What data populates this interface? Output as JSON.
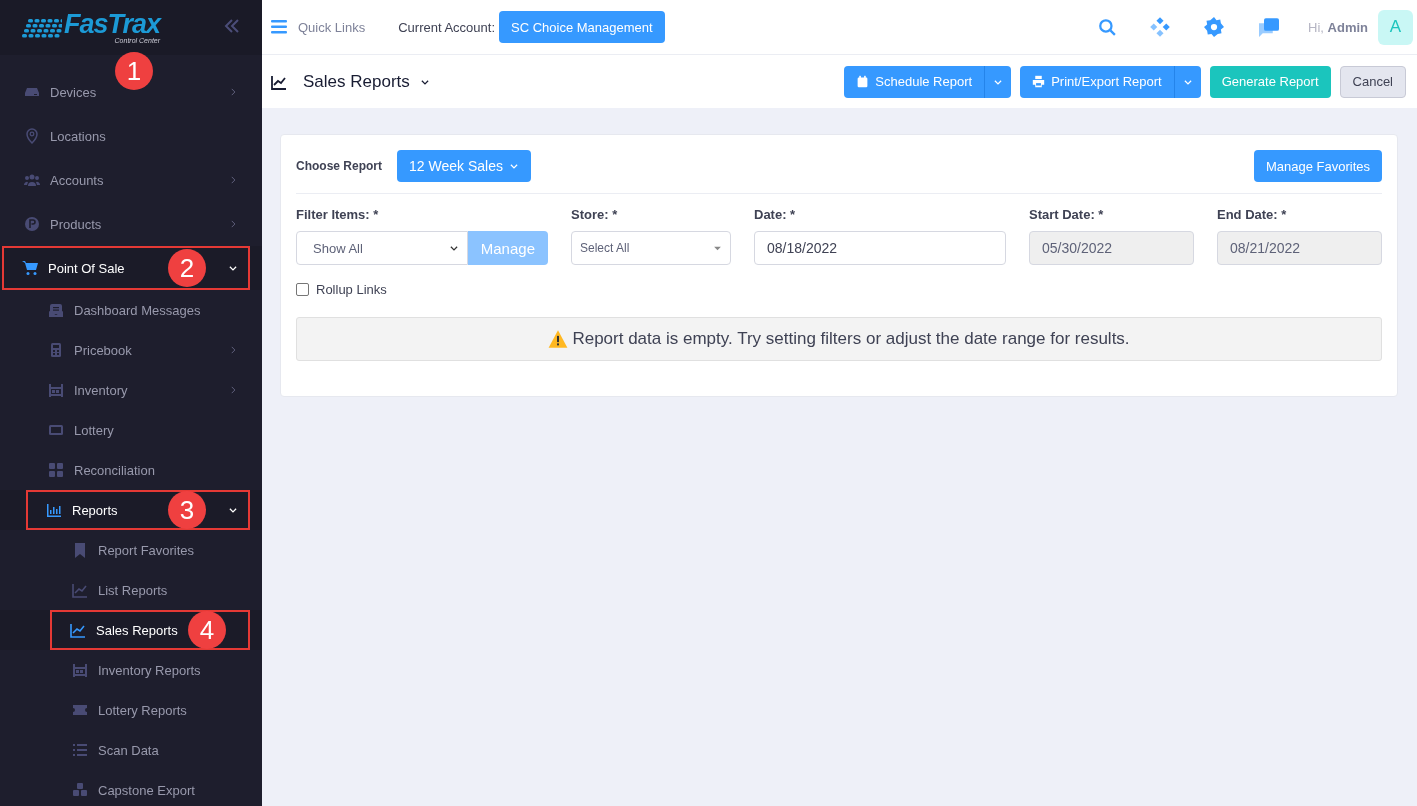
{
  "sidebar": {
    "logo": {
      "name": "FasTrax",
      "tagline": "Control Center"
    },
    "callout": "1",
    "items": [
      {
        "label": "Devices",
        "expanded": false,
        "selected": false
      },
      {
        "label": "Locations",
        "selected": false
      },
      {
        "label": "Accounts",
        "expanded": false,
        "selected": false
      },
      {
        "label": "Products",
        "expanded": false,
        "selected": false
      },
      {
        "label": "Point Of Sale",
        "expanded": true,
        "selected": true,
        "callout": "2",
        "children": [
          {
            "label": "Dashboard Messages",
            "selected": false
          },
          {
            "label": "Pricebook",
            "expanded": false,
            "selected": false
          },
          {
            "label": "Inventory",
            "expanded": false,
            "selected": false
          },
          {
            "label": "Lottery",
            "selected": false
          },
          {
            "label": "Reconciliation",
            "selected": false
          },
          {
            "label": "Reports",
            "expanded": true,
            "selected": true,
            "callout": "3",
            "children": [
              {
                "label": "Report Favorites",
                "selected": false
              },
              {
                "label": "List Reports",
                "selected": false
              },
              {
                "label": "Sales Reports",
                "selected": true,
                "callout": "4"
              },
              {
                "label": "Inventory Reports",
                "selected": false
              },
              {
                "label": "Lottery Reports",
                "selected": false
              },
              {
                "label": "Scan Data",
                "selected": false
              },
              {
                "label": "Capstone Export",
                "selected": false
              }
            ]
          }
        ]
      }
    ]
  },
  "topbar": {
    "quick_links": "Quick Links",
    "account_label": "Current Account:",
    "account": "SC Choice Management",
    "greeting": "Hi, **Admin**",
    "avatar": "A"
  },
  "subheader": {
    "title": "Sales Reports",
    "buttons": [
      {
        "label": "Schedule Report",
        "kind": "split"
      },
      {
        "label": "Print/Export Report",
        "kind": "split"
      },
      {
        "label": "Generate Report",
        "kind": "primary"
      },
      {
        "label": "Cancel",
        "kind": "light"
      }
    ]
  },
  "card": {
    "choose_label": "Choose Report",
    "report": "12 Week Sales",
    "favorites": "Manage Favorites",
    "filters": [
      {
        "label": "Filter Items: *",
        "kind": "select-manage",
        "value": "Show All",
        "button": {
          "label": "Manage",
          "disabled": true
        }
      },
      {
        "label": "Store: *",
        "kind": "select",
        "value": "Select All"
      },
      {
        "label": "Date: *",
        "kind": "date",
        "value": "08/18/2022",
        "disabled": false
      },
      {
        "label": "Start Date: *",
        "kind": "date",
        "value": "05/30/2022",
        "disabled": true
      },
      {
        "label": "End Date: *",
        "kind": "date",
        "value": "08/21/2022",
        "disabled": true
      }
    ],
    "rollup": {
      "label": "Rollup Links",
      "checked": false
    },
    "alert": "Report data is empty. Try setting filters or adjust the date range for results."
  }
}
